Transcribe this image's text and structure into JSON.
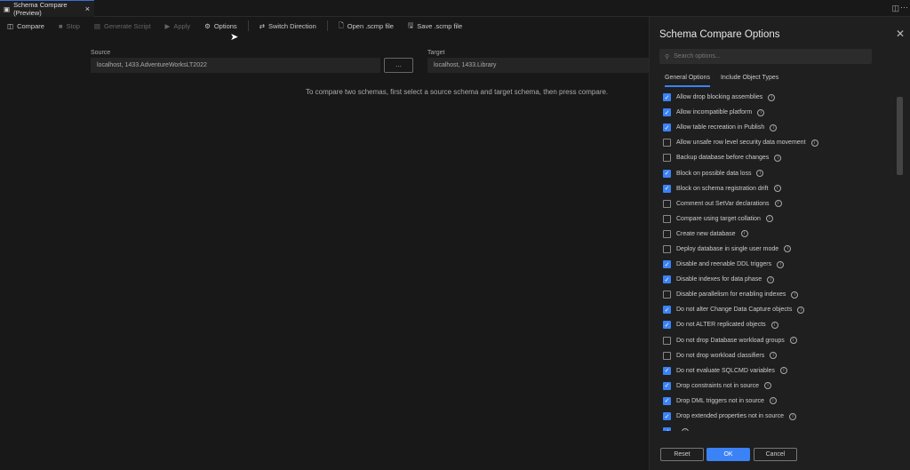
{
  "tab": {
    "title": "Schema Compare (Preview)"
  },
  "toolbar": {
    "compare": "Compare",
    "stop": "Stop",
    "generate": "Generate Script",
    "apply": "Apply",
    "options": "Options",
    "switch": "Switch Direction",
    "open": "Open .scmp file",
    "save": "Save .scmp file"
  },
  "source": {
    "label": "Source",
    "value": "localhost, 1433.AdventureWorksLT2022"
  },
  "browse_label": "...",
  "target": {
    "label": "Target",
    "value": "localhost, 1433.Library"
  },
  "hint": "To compare two schemas, first select a source schema and target schema, then press compare.",
  "panel": {
    "title": "Schema Compare Options",
    "search_placeholder": "Search options...",
    "tabs": [
      "General Options",
      "Include Object Types"
    ],
    "options": [
      {
        "label": "Allow drop blocking assemblies",
        "checked": true
      },
      {
        "label": "Allow incompatible platform",
        "checked": true
      },
      {
        "label": "Allow table recreation in Publish",
        "checked": true
      },
      {
        "label": "Allow unsafe row level security data movement",
        "checked": false
      },
      {
        "label": "Backup database before changes",
        "checked": false
      },
      {
        "label": "Block on possible data loss",
        "checked": true
      },
      {
        "label": "Block on schema registration drift",
        "checked": true
      },
      {
        "label": "Comment out SetVar declarations",
        "checked": false
      },
      {
        "label": "Compare using target collation",
        "checked": false
      },
      {
        "label": "Create new database",
        "checked": false
      },
      {
        "label": "Deploy database in single user mode",
        "checked": false
      },
      {
        "label": "Disable and reenable DDL triggers",
        "checked": true
      },
      {
        "label": "Disable indexes for data phase",
        "checked": true
      },
      {
        "label": "Disable parallelism for enabling indexes",
        "checked": false
      },
      {
        "label": "Do not alter Change Data Capture objects",
        "checked": true
      },
      {
        "label": "Do not ALTER replicated objects",
        "checked": true
      },
      {
        "label": "Do not drop Database workload groups",
        "checked": false
      },
      {
        "label": "Do not drop workload classifiers",
        "checked": false
      },
      {
        "label": "Do not evaluate SQLCMD variables",
        "checked": true
      },
      {
        "label": "Drop constraints not in source",
        "checked": true
      },
      {
        "label": "Drop DML triggers not in source",
        "checked": true
      },
      {
        "label": "Drop extended properties not in source",
        "checked": true
      },
      {
        "label": "",
        "checked": true
      }
    ],
    "reset": "Reset",
    "ok": "OK",
    "cancel": "Cancel"
  },
  "colors": {
    "accent": "#3b82f6"
  }
}
